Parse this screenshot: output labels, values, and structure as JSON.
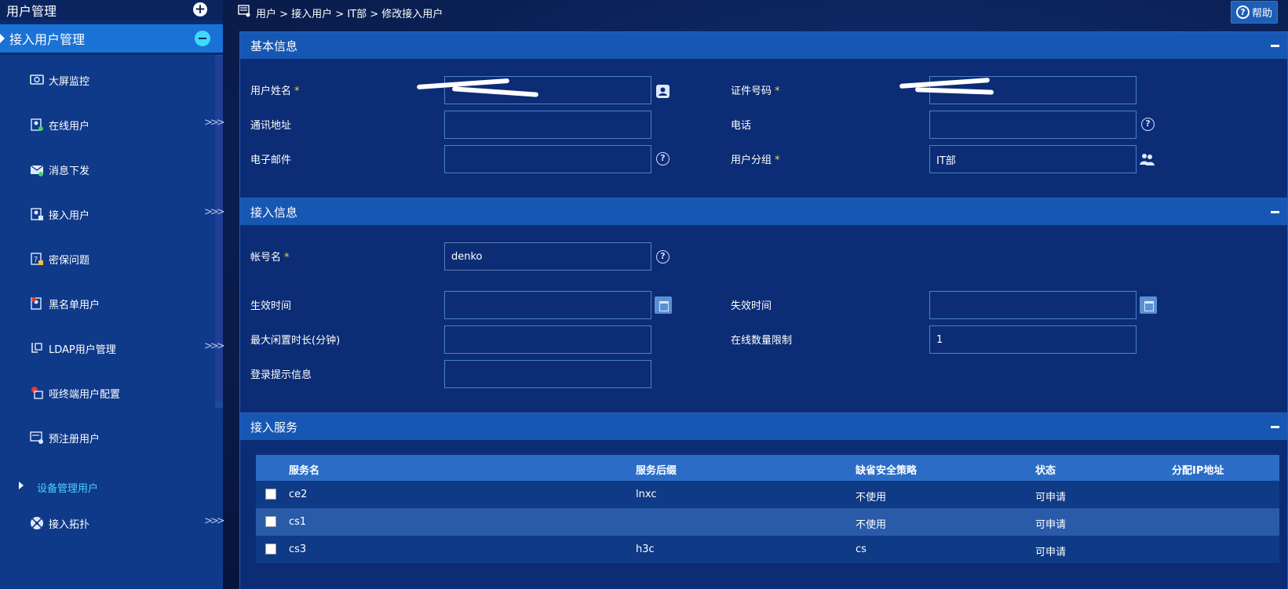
{
  "sidebar": {
    "header_label": "用户管理",
    "active_label": "接入用户管理",
    "items": [
      {
        "label": "大屏监控",
        "icon": "monitor-icon",
        "arrow": ""
      },
      {
        "label": "在线用户",
        "icon": "online-user-icon",
        "arrow": ">>>"
      },
      {
        "label": "消息下发",
        "icon": "message-icon",
        "arrow": ""
      },
      {
        "label": "接入用户",
        "icon": "access-user-icon",
        "arrow": ">>>"
      },
      {
        "label": "密保问题",
        "icon": "security-question-icon",
        "arrow": ""
      },
      {
        "label": "黑名单用户",
        "icon": "blacklist-icon",
        "arrow": ""
      },
      {
        "label": "LDAP用户管理",
        "icon": "ldap-icon",
        "arrow": ">>>"
      },
      {
        "label": "哑终端用户配置",
        "icon": "dumb-terminal-icon",
        "arrow": ""
      },
      {
        "label": "预注册用户",
        "icon": "preregister-icon",
        "arrow": ""
      },
      {
        "label": "设备管理用户",
        "icon": "",
        "arrow": ""
      },
      {
        "label": "接入拓扑",
        "icon": "topology-icon",
        "arrow": ">>>"
      }
    ]
  },
  "breadcrumb": {
    "text": "用户 > 接入用户 >  IT部  > 修改接入用户"
  },
  "help": {
    "label": "帮助"
  },
  "basic_info": {
    "title": "基本信息",
    "username_label": "用户姓名",
    "id_number_label": "证件号码",
    "address_label": "通讯地址",
    "phone_label": "电话",
    "email_label": "电子邮件",
    "group_label": "用户分组",
    "group_value": "IT部",
    "required_mark": "*"
  },
  "access_info": {
    "title": "接入信息",
    "account_label": "帐号名",
    "account_value": "denko",
    "effective_label": "生效时间",
    "expire_label": "失效时间",
    "max_idle_label": "最大闲置时长(分钟)",
    "online_limit_label": "在线数量限制",
    "online_limit_value": "1",
    "login_prompt_label": "登录提示信息",
    "required_mark": "*"
  },
  "access_service": {
    "title": "接入服务",
    "columns": [
      "服务名",
      "服务后缀",
      "缺省安全策略",
      "状态",
      "分配IP地址"
    ],
    "rows": [
      {
        "name": "ce2",
        "suffix": "lnxc",
        "policy": "不使用",
        "status": "可申请"
      },
      {
        "name": "cs1",
        "suffix": "",
        "policy": "不使用",
        "status": "可申请"
      },
      {
        "name": "cs3",
        "suffix": "h3c",
        "policy": "cs",
        "status": "可申请"
      }
    ]
  },
  "colors": {
    "accent": "#1a72d6",
    "panel_header": "#1757b4",
    "required": "#ffd24a",
    "submenu_text": "#4dd0ff"
  }
}
